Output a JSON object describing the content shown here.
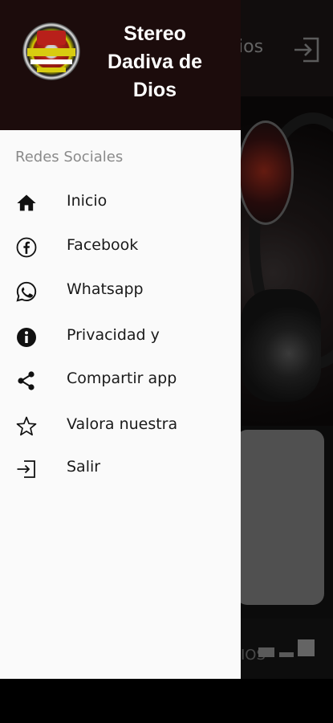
{
  "background": {
    "title_fragment": "ios",
    "bottom_fragment": "IOS"
  },
  "drawer": {
    "title": "Stereo Dadiva de Dios",
    "section_label": "Redes Sociales",
    "items": [
      {
        "label": "Inicio",
        "icon": "home-icon"
      },
      {
        "label": "Facebook",
        "icon": "facebook-icon"
      },
      {
        "label": "Whatsapp",
        "icon": "whatsapp-icon"
      },
      {
        "label": "Privacidad y",
        "icon": "info-icon"
      },
      {
        "label": "Compartir app",
        "icon": "share-icon"
      },
      {
        "label": "Valora nuestra",
        "icon": "star-icon"
      },
      {
        "label": "Salir",
        "icon": "exit-icon"
      }
    ]
  },
  "colors": {
    "drawer_header": "#1c0c0c",
    "drawer_bg": "#fafafa",
    "icon": "#111111"
  }
}
